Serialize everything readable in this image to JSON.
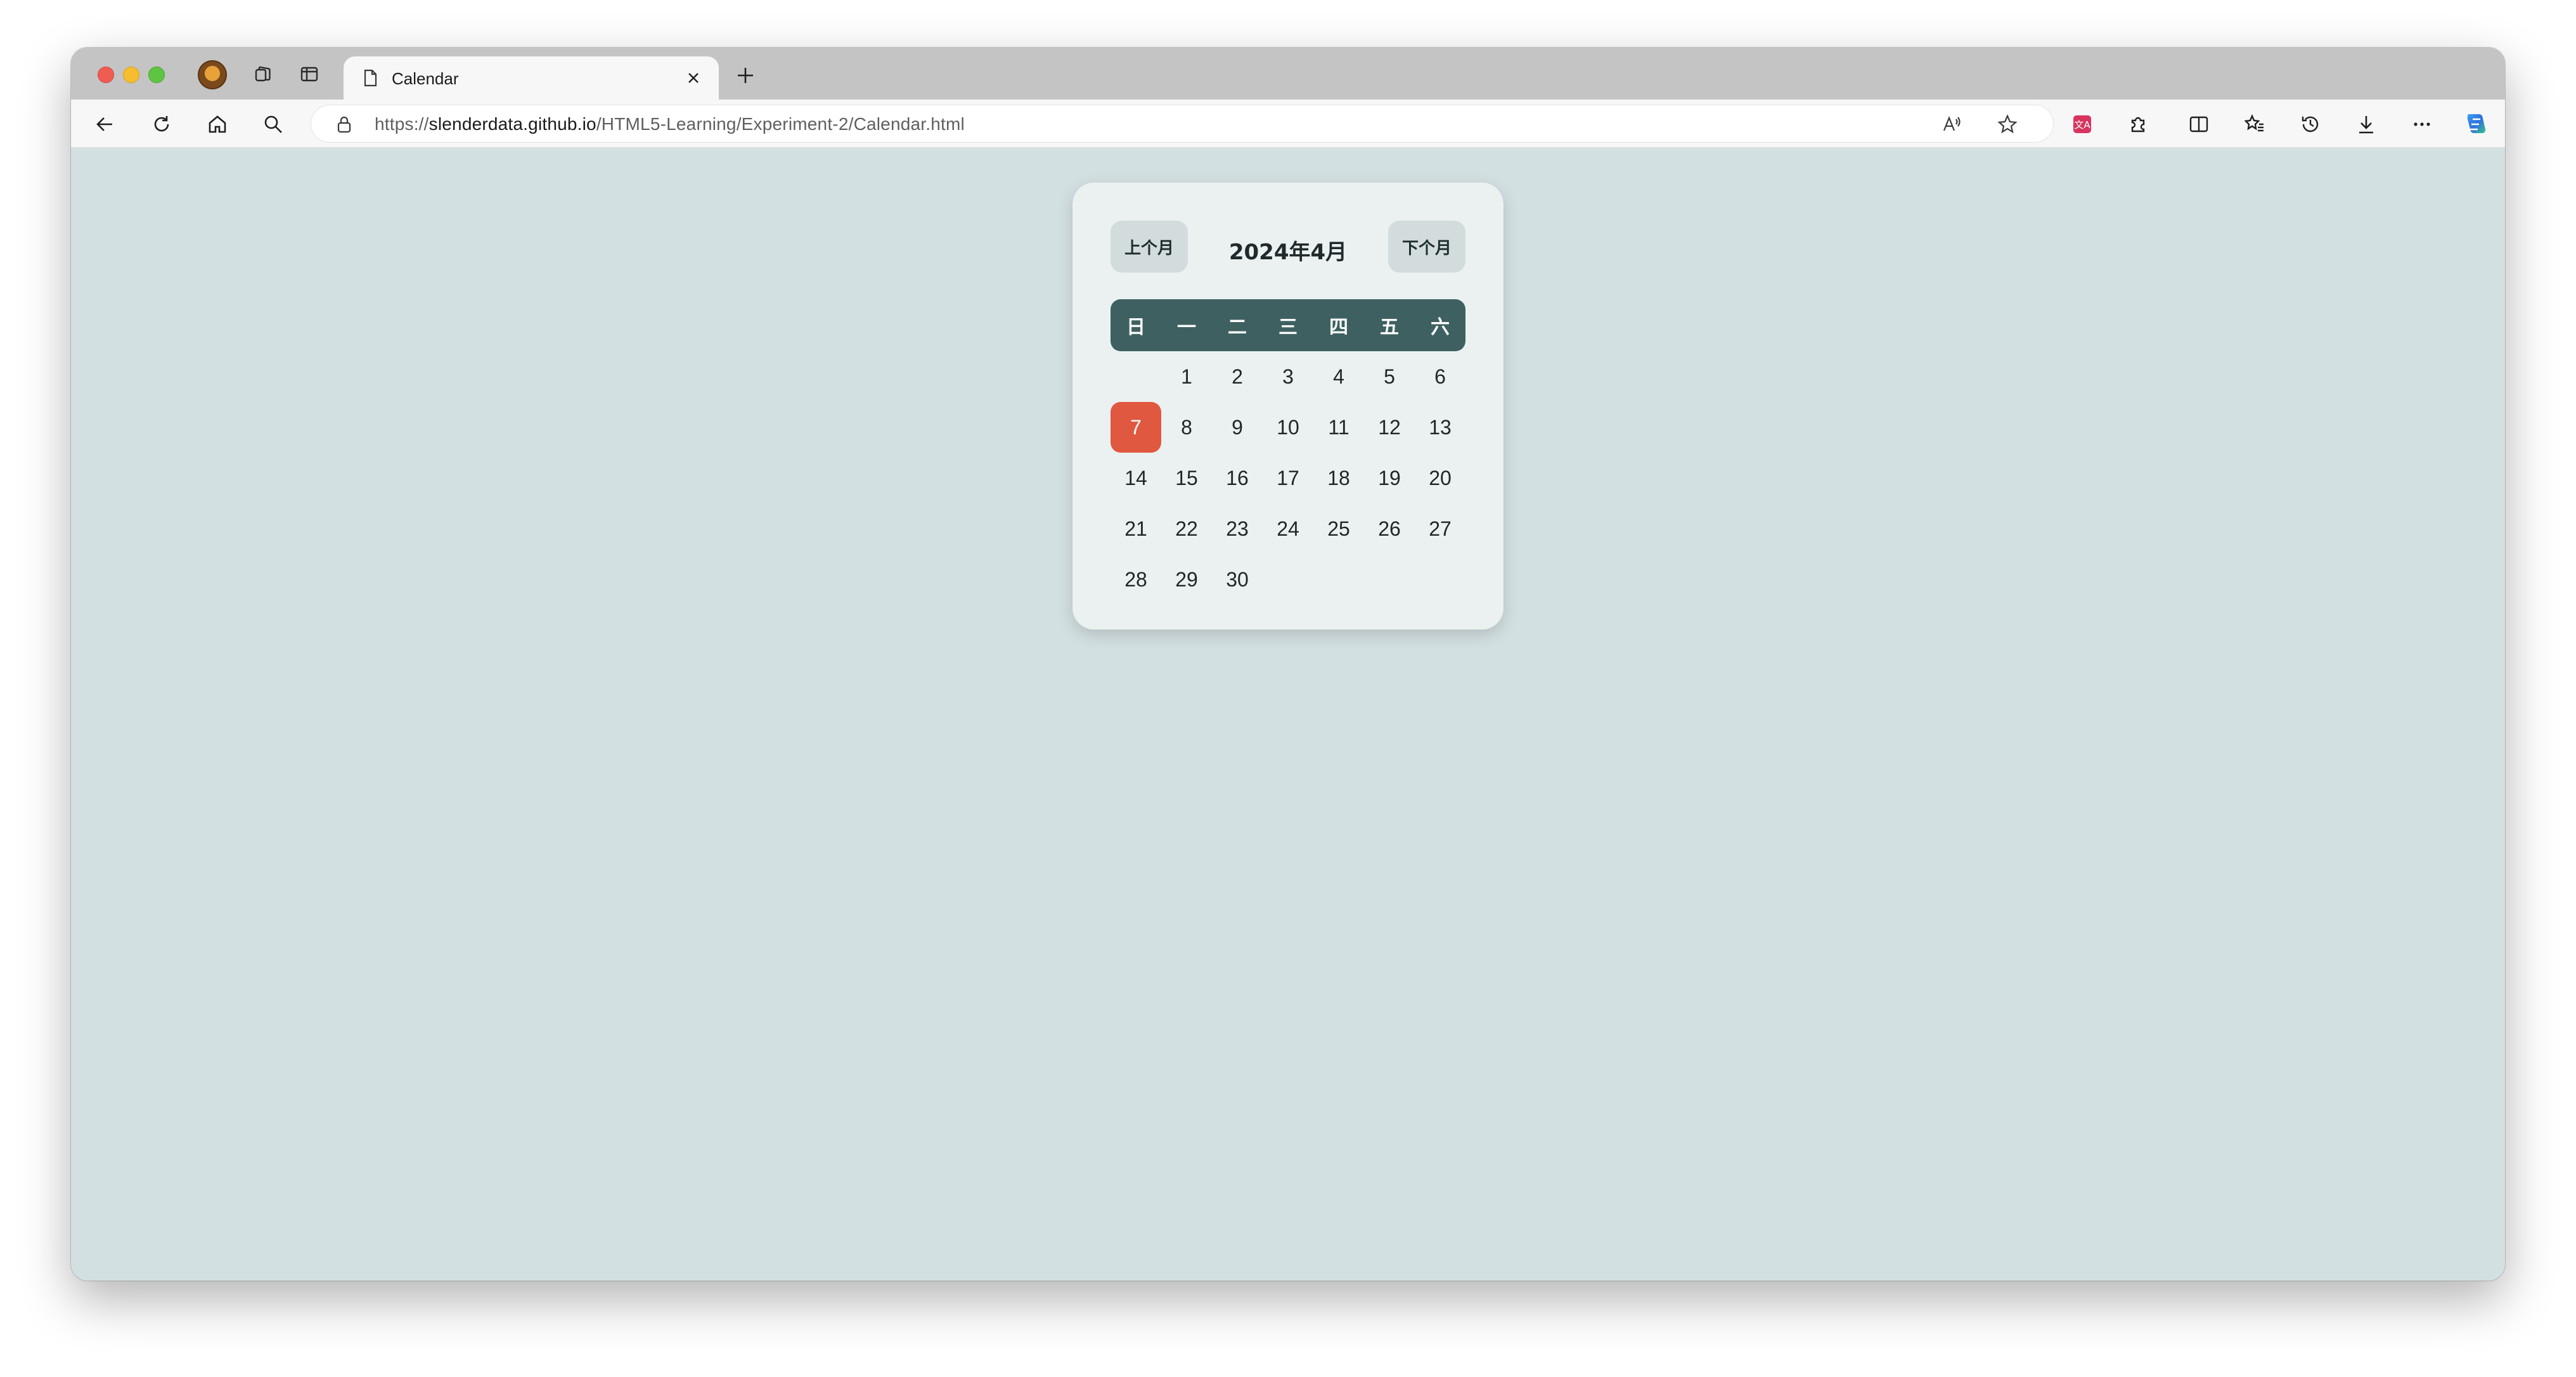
{
  "browser": {
    "tab": {
      "title": "Calendar"
    },
    "address": {
      "protocol": "https://",
      "host": "slenderdata.github.io",
      "path": "/HTML5-Learning/Experiment-2/Calendar.html"
    },
    "colors": {
      "tab_strip": "#c4c4c4",
      "toolbar": "#f7f7f7"
    },
    "icons": [
      "close-icon",
      "minimize-icon",
      "maximize-icon",
      "profile-avatar",
      "collections-icon",
      "vertical-tabs-icon",
      "page-icon",
      "tab-close-icon",
      "new-tab-icon",
      "back-icon",
      "refresh-icon",
      "home-icon",
      "search-icon",
      "lock-icon",
      "read-aloud-icon",
      "favorite-star-icon",
      "extension-icon",
      "puzzle-icon",
      "split-screen-icon",
      "favorites-icon",
      "history-icon",
      "download-icon",
      "more-icon",
      "copilot-icon"
    ]
  },
  "calendar": {
    "prev_label": "上个月",
    "next_label": "下个月",
    "title": "2024年4月",
    "weekdays": [
      "日",
      "一",
      "二",
      "三",
      "四",
      "五",
      "六"
    ],
    "days": [
      "",
      "1",
      "2",
      "3",
      "4",
      "5",
      "6",
      "7",
      "8",
      "9",
      "10",
      "11",
      "12",
      "13",
      "14",
      "15",
      "16",
      "17",
      "18",
      "19",
      "20",
      "21",
      "22",
      "23",
      "24",
      "25",
      "26",
      "27",
      "28",
      "29",
      "30"
    ],
    "today": "7",
    "colors": {
      "page_background": "#d3e0e2",
      "card_background": "#ebf1f1",
      "weekday_bar": "#3e6060",
      "today_highlight": "#e0583f",
      "button_background": "#d2dcdc"
    }
  }
}
